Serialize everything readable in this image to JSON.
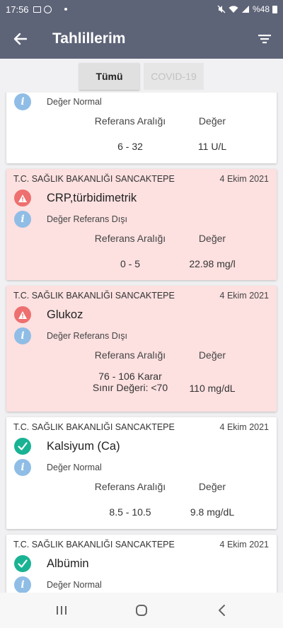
{
  "status_bar": {
    "time": "17:56",
    "battery": "%48"
  },
  "header": {
    "title": "Tahlillerim"
  },
  "tabs": [
    {
      "label": "Tümü",
      "active": true
    },
    {
      "label": "COVID-19",
      "active": false
    }
  ],
  "labels": {
    "reference_range": "Referans Aralığı",
    "value": "Değer"
  },
  "colors": {
    "header_bg": "#5e6478",
    "alert_card_bg": "#fde0e0",
    "ok_icon": "#19b394",
    "warn_icon": "#ee6f6f",
    "info_icon": "#8fbde6"
  },
  "results": [
    {
      "institution": "",
      "date": "",
      "test_name": "",
      "status": "Değer Normal",
      "status_icon": "info-icon",
      "reference_range": "6 - 32",
      "value": "11 U/L",
      "alert": false
    },
    {
      "institution": "T.C. SAĞLIK BAKANLIĞI SANCAKTEPE",
      "date": "4 Ekim 2021",
      "test_name": "CRP,türbidimetrik",
      "status": "Değer Referans Dışı",
      "status_icon": "warning-icon",
      "reference_range": "0 - 5",
      "value": "22.98 mg/l",
      "alert": true
    },
    {
      "institution": "T.C. SAĞLIK BAKANLIĞI SANCAKTEPE",
      "date": "4 Ekim 2021",
      "test_name": "Glukoz",
      "status": "Değer Referans Dışı",
      "status_icon": "warning-icon",
      "reference_range": "76 - 106  Karar Sınır Değeri: <70",
      "value": "110 mg/dL",
      "alert": true
    },
    {
      "institution": "T.C. SAĞLIK BAKANLIĞI SANCAKTEPE",
      "date": "4 Ekim 2021",
      "test_name": "Kalsiyum (Ca)",
      "status": "Değer Normal",
      "status_icon": "check-icon",
      "reference_range": "8.5 - 10.5",
      "value": "9.8 mg/dL",
      "alert": false
    },
    {
      "institution": "T.C. SAĞLIK BAKANLIĞI SANCAKTEPE",
      "date": "4 Ekim 2021",
      "test_name": "Albümin",
      "status": "Değer Normal",
      "status_icon": "check-icon",
      "reference_range": "",
      "value": "",
      "alert": false
    }
  ]
}
